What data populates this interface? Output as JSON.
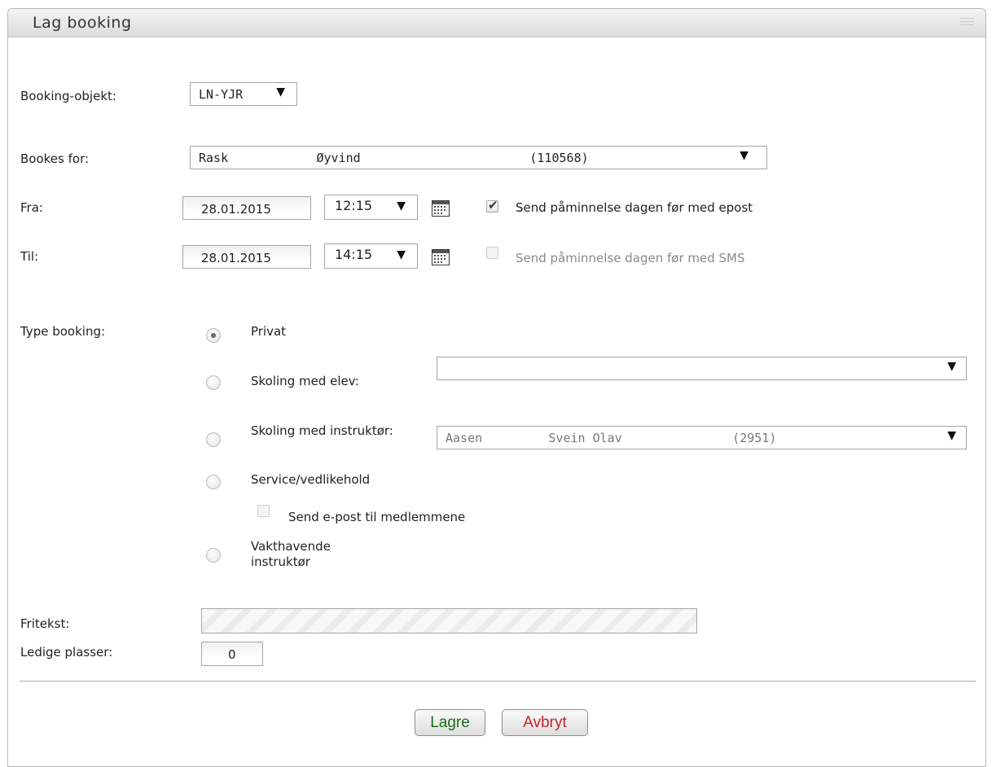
{
  "panel": {
    "title": "Lag booking"
  },
  "form": {
    "booking_object_label": "Booking-objekt:",
    "booking_object_value": "LN-YJR",
    "booked_for_label": "Bookes for:",
    "booked_for_value": "Rask            Øyvind                       (110568)",
    "from_label": "Fra:",
    "from_date": "28.01.2015",
    "from_time": "12:15",
    "reminder_email_label": "Send påminnelse dagen før med epost",
    "reminder_email_checked": true,
    "to_label": "Til:",
    "to_date": "28.01.2015",
    "to_time": "14:15",
    "reminder_sms_label": "Send påminnelse dagen før med SMS",
    "reminder_sms_checked": false,
    "type_label": "Type booking:",
    "types": [
      {
        "label": "Privat",
        "selected": true
      },
      {
        "label": "Skoling med elev:",
        "selected": false
      },
      {
        "label": "Skoling med instruktør:",
        "selected": false
      },
      {
        "label": "Service/vedlikehold",
        "selected": false
      },
      {
        "label": "Vakthavende instruktør",
        "selected": false
      }
    ],
    "student_select_value": "",
    "instructor_select_value": "Aasen         Svein Olav               (2951)",
    "send_email_members_label": "Send e-post til medlemmene",
    "free_text_label": "Fritekst:",
    "free_text_value": "",
    "free_seats_label": "Ledige plasser:",
    "free_seats_value": "0"
  },
  "buttons": {
    "save": "Lagre",
    "cancel": "Avbryt"
  },
  "icons": {
    "dropdown": "dropdown-arrow-icon",
    "calendar": "calendar-icon",
    "grip": "grip-icon"
  },
  "colors": {
    "cancel_text": "#c0262c",
    "save_text": "#1b6b1b"
  }
}
